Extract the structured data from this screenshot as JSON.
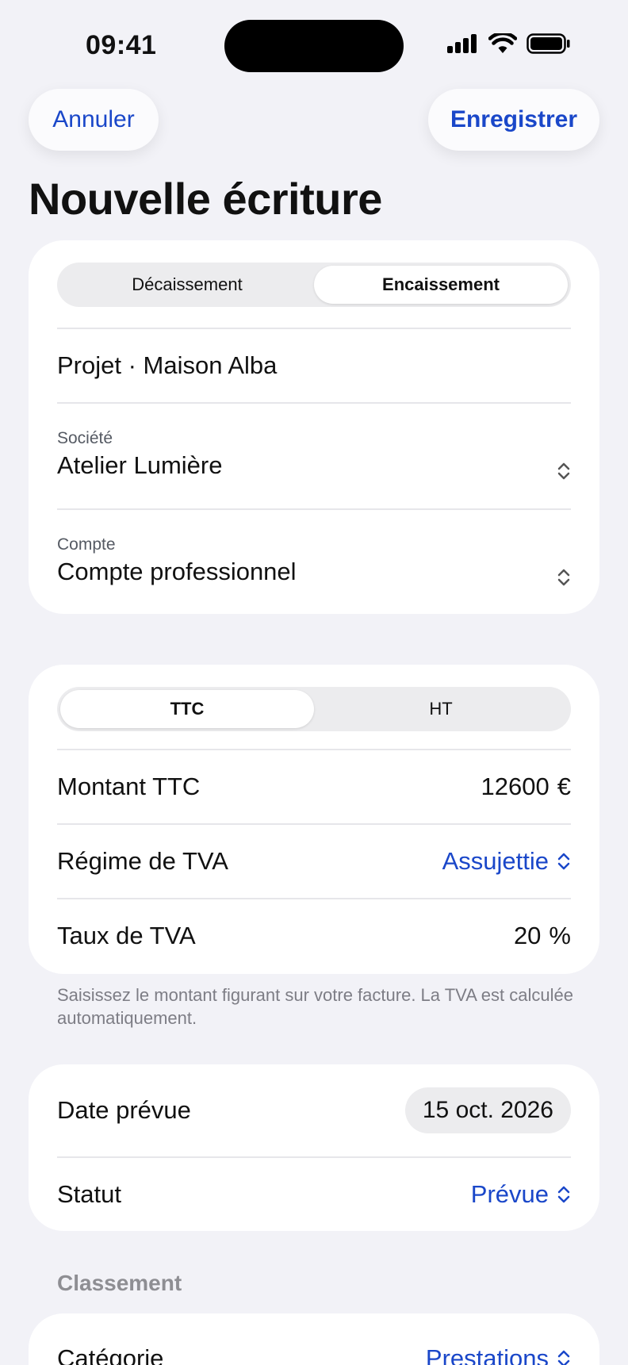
{
  "status_bar": {
    "time": "09:41",
    "icons": [
      "cellular-signal-icon",
      "wifi-icon",
      "battery-icon"
    ]
  },
  "nav": {
    "cancel_label": "Annuler",
    "save_label": "Enregistrer"
  },
  "title": "Nouvelle écriture",
  "transaction_card": {
    "type_segments": [
      "Décaissement",
      "Encaissement"
    ],
    "selected_type": "Encaissement",
    "project": "Projet · Maison Alba",
    "company_label": "Société",
    "company_value": "Atelier Lumière",
    "account_label": "Compte",
    "account_value": "Compte professionnel"
  },
  "amount_card": {
    "mode_segments": [
      "TTC",
      "HT"
    ],
    "selected_mode": "TTC",
    "amount_label": "Montant TTC",
    "amount_value": "12600",
    "amount_unit": "€",
    "vat_regime_label": "Régime de TVA",
    "vat_regime_value": "Assujettie",
    "vat_rate_label": "Taux de TVA",
    "vat_rate_value": "20",
    "vat_rate_unit": "%"
  },
  "footnote": "Saisissez le montant figurant sur votre facture. La TVA est calculée automatiquement.",
  "schedule_card": {
    "date_label": "Date prévue",
    "date_value": "15 oct. 2026",
    "status_label": "Statut",
    "status_value": "Prévue"
  },
  "classification": {
    "header": "Classement",
    "category_label": "Catégorie",
    "category_value": "Prestations"
  },
  "colors": {
    "accent": "#1a47c9",
    "background": "#f2f2f7",
    "card": "#ffffff",
    "segment_track": "#ececee"
  }
}
